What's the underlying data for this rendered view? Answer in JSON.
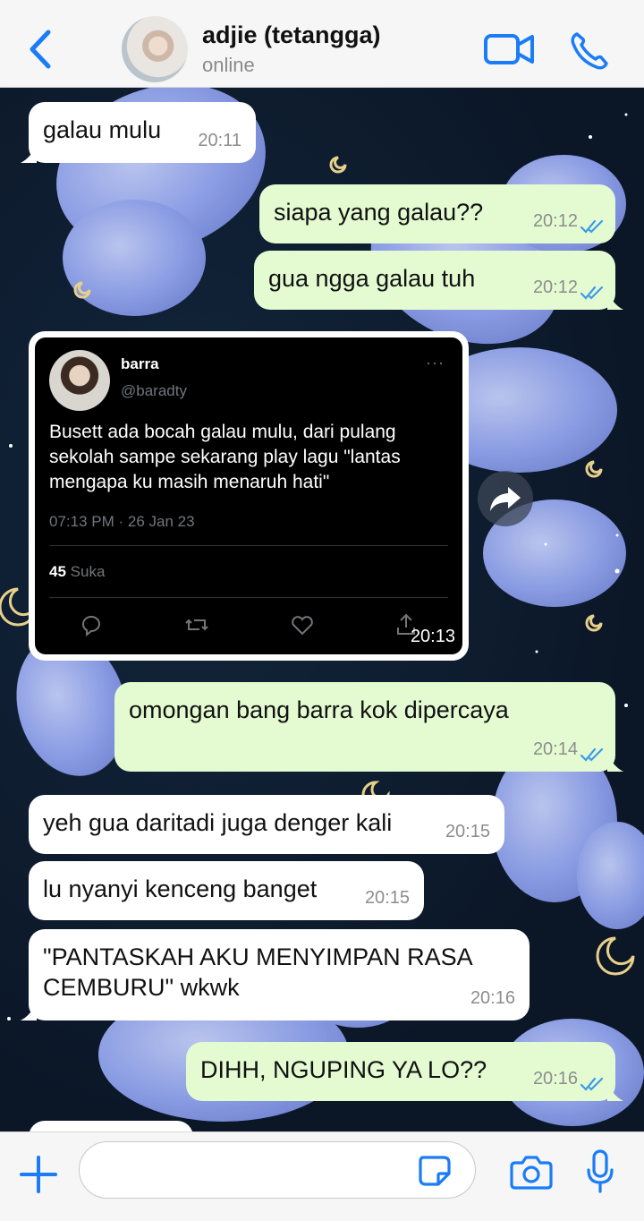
{
  "header": {
    "contact_name": "adjie (tetangga)",
    "status": "online",
    "back_icon": "chevron-left-icon",
    "video_icon": "video-camera-icon",
    "call_icon": "phone-icon"
  },
  "colors": {
    "accent": "#1a7cf6",
    "incoming_bubble": "#ffffff",
    "outgoing_bubble": "#e4fbd2",
    "read_ticks": "#3d9be9",
    "wallpaper_bg": "#0d1a2b"
  },
  "messages": [
    {
      "dir": "in",
      "text": "galau mulu",
      "time": "20:11"
    },
    {
      "dir": "out",
      "text": "siapa yang galau??",
      "time": "20:12",
      "read": true
    },
    {
      "dir": "out",
      "text": "gua ngga galau tuh",
      "time": "20:12",
      "read": true
    },
    {
      "dir": "in",
      "type": "tweet-screenshot",
      "time": "20:13"
    },
    {
      "dir": "out",
      "text": "omongan bang barra kok dipercaya",
      "time": "20:14",
      "read": true
    },
    {
      "dir": "in",
      "text": "yeh gua daritadi juga denger kali",
      "time": "20:15"
    },
    {
      "dir": "in",
      "text": "lu nyanyi kenceng banget",
      "time": "20:15"
    },
    {
      "dir": "in",
      "text": "\"PANTASKAH AKU MENYIMPAN RASA CEMBURU\" wkwk",
      "time": "20:16"
    },
    {
      "dir": "out",
      "text": "DIHH, NGUPING YA LO??",
      "time": "20:16",
      "read": true
    }
  ],
  "tweet": {
    "name": "barra",
    "handle": "@baradty",
    "more": "···",
    "text": "Busett ada bocah galau mulu, dari pulang sekolah sampe sekarang play lagu \"lantas mengapa ku masih menaruh hati\"",
    "date": "07:13 PM · 26 Jan 23",
    "likes_count": "45",
    "likes_label": "Suka"
  },
  "composer": {
    "placeholder": "",
    "plus_icon": "plus-icon",
    "sticker_icon": "sticker-icon",
    "camera_icon": "camera-icon",
    "mic_icon": "microphone-icon"
  }
}
